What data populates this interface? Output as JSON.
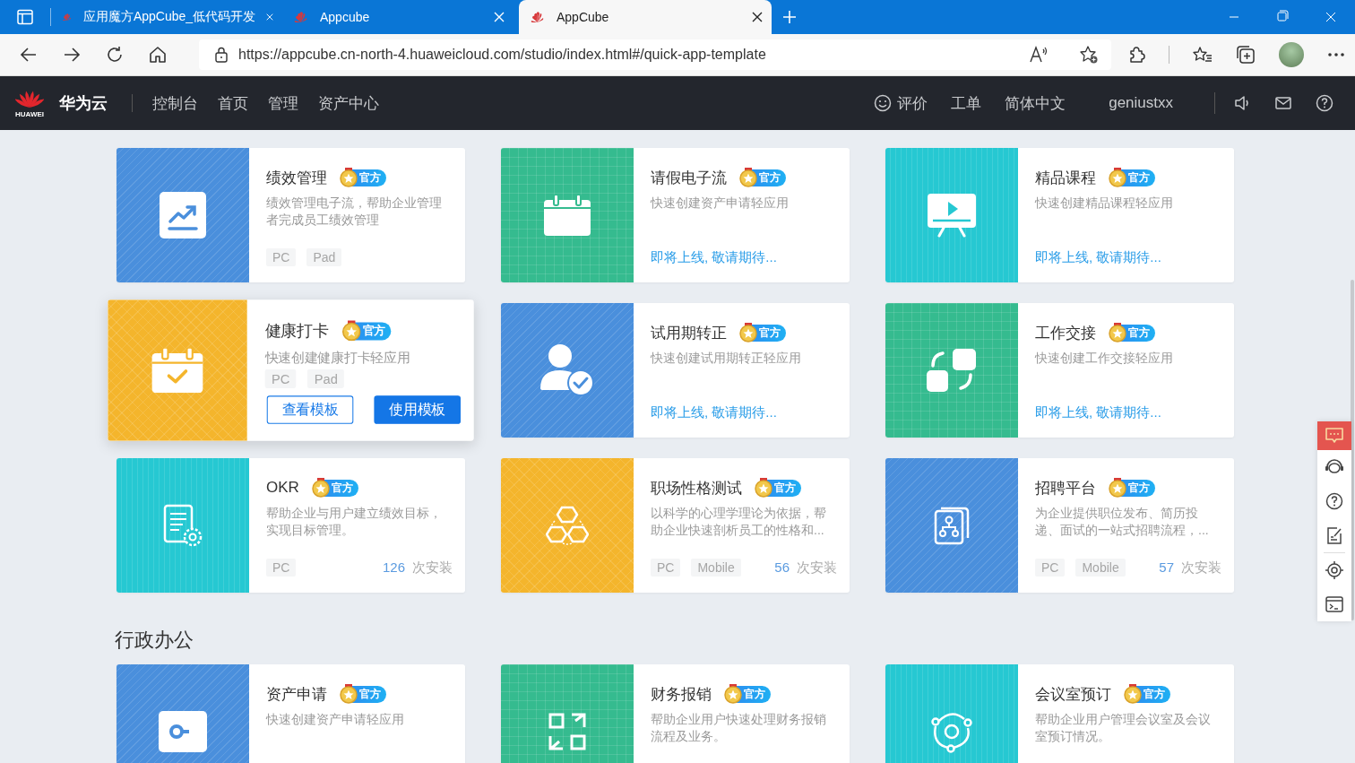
{
  "browser": {
    "tabs": [
      {
        "title": "应用魔方AppCube_低代码开发",
        "selected": false
      },
      {
        "title": "Appcube",
        "selected": false
      },
      {
        "title": "AppCube",
        "selected": true
      }
    ],
    "url": "https://appcube.cn-north-4.huaweicloud.com/studio/index.html#/quick-app-template"
  },
  "header": {
    "logo_text": "HUAWEI",
    "brand": "华为云",
    "nav": [
      "控制台",
      "首页",
      "管理",
      "资产中心"
    ],
    "feedback": "评价",
    "tickets": "工单",
    "language": "简体中文",
    "user": "geniustxx"
  },
  "sections": [
    {
      "cards": [
        {
          "title": "绩效管理",
          "badge": "官方",
          "description": "绩效管理电子流，帮助企业管理者完成员工绩效管理",
          "tags": [
            "PC",
            "Pad"
          ],
          "hovered": false,
          "color": "#4a8fdc"
        },
        {
          "title": "请假电子流",
          "badge": "官方",
          "description": "快速创建资产申请轻应用",
          "status": "即将上线, 敬请期待...",
          "hovered": false,
          "color": "#35bb8f"
        },
        {
          "title": "精品课程",
          "badge": "官方",
          "description": "快速创建精品课程轻应用",
          "status": "即将上线, 敬请期待...",
          "hovered": false,
          "color": "#26c8d2"
        },
        {
          "title": "健康打卡",
          "badge": "官方",
          "description": "快速创建健康打卡轻应用",
          "tags": [
            "PC",
            "Pad"
          ],
          "hovered": true,
          "buttons": [
            {
              "label": "查看模板",
              "kind": "outline"
            },
            {
              "label": "使用模板",
              "kind": "primary"
            }
          ],
          "color": "#f4b52c"
        },
        {
          "title": "试用期转正",
          "badge": "官方",
          "description": "快速创建试用期转正轻应用",
          "status": "即将上线, 敬请期待...",
          "hovered": false,
          "color": "#4a8fdc"
        },
        {
          "title": "工作交接",
          "badge": "官方",
          "description": "快速创建工作交接轻应用",
          "status": "即将上线, 敬请期待...",
          "hovered": false,
          "color": "#35bb8f"
        },
        {
          "title": "OKR",
          "badge": "官方",
          "description": "帮助企业与用户建立绩效目标，实现目标管理。",
          "tags": [
            "PC"
          ],
          "installs": "126",
          "install_label": "次安装",
          "hovered": false,
          "color": "#26c8d2"
        },
        {
          "title": "职场性格测试",
          "badge": "官方",
          "description": "以科学的心理学理论为依据，帮助企业快速剖析员工的性格和...",
          "tags": [
            "PC",
            "Mobile"
          ],
          "installs": "56",
          "install_label": "次安装",
          "hovered": false,
          "color": "#f4b52c"
        },
        {
          "title": "招聘平台",
          "badge": "官方",
          "description": "为企业提供职位发布、简历投递、面试的一站式招聘流程，...",
          "tags": [
            "PC",
            "Mobile"
          ],
          "installs": "57",
          "install_label": "次安装",
          "hovered": false,
          "color": "#4a8fdc"
        }
      ]
    },
    {
      "title": "行政办公",
      "cards": [
        {
          "title": "资产申请",
          "badge": "官方",
          "description": "快速创建资产申请轻应用",
          "hovered": false,
          "color": "#4a8fdc"
        },
        {
          "title": "财务报销",
          "badge": "官方",
          "description": "帮助企业用户快速处理财务报销流程及业务。",
          "hovered": false,
          "color": "#35bb8f"
        },
        {
          "title": "会议室预订",
          "badge": "官方",
          "description": "帮助企业用户管理会议室及会议室预订情况。",
          "hovered": false,
          "color": "#26c8d2"
        }
      ]
    }
  ]
}
